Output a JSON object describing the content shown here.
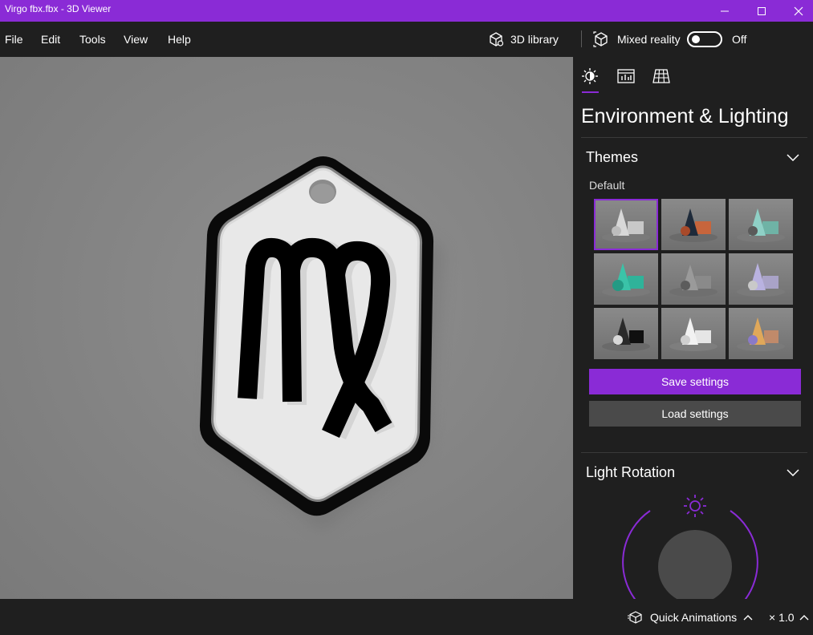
{
  "window": {
    "title": "Virgo fbx.fbx - 3D Viewer",
    "accent": "#8a2bd6",
    "controls": [
      "minimize-icon",
      "maximize-icon",
      "close-icon"
    ]
  },
  "menu": {
    "items": [
      {
        "label": "File"
      },
      {
        "label": "Edit"
      },
      {
        "label": "Tools"
      },
      {
        "label": "View"
      },
      {
        "label": "Help"
      }
    ],
    "library_label": "3D library",
    "mixed_reality_label": "Mixed reality",
    "mixed_reality_state": "Off"
  },
  "panel": {
    "tabs": [
      {
        "name": "environment-lighting",
        "icon": "sun-icon",
        "selected": true
      },
      {
        "name": "stats-shading",
        "icon": "stats-icon",
        "selected": false
      },
      {
        "name": "grid-views",
        "icon": "grid-icon",
        "selected": false
      }
    ],
    "title": "Environment & Lighting",
    "themes": {
      "heading": "Themes",
      "selected_name": "Default",
      "selected_index": 0
    },
    "save_label": "Save settings",
    "load_label": "Load settings",
    "light_rotation_heading": "Light Rotation"
  },
  "statusbar": {
    "animations_label": "Quick Animations",
    "speed_label": "× 1.0"
  }
}
